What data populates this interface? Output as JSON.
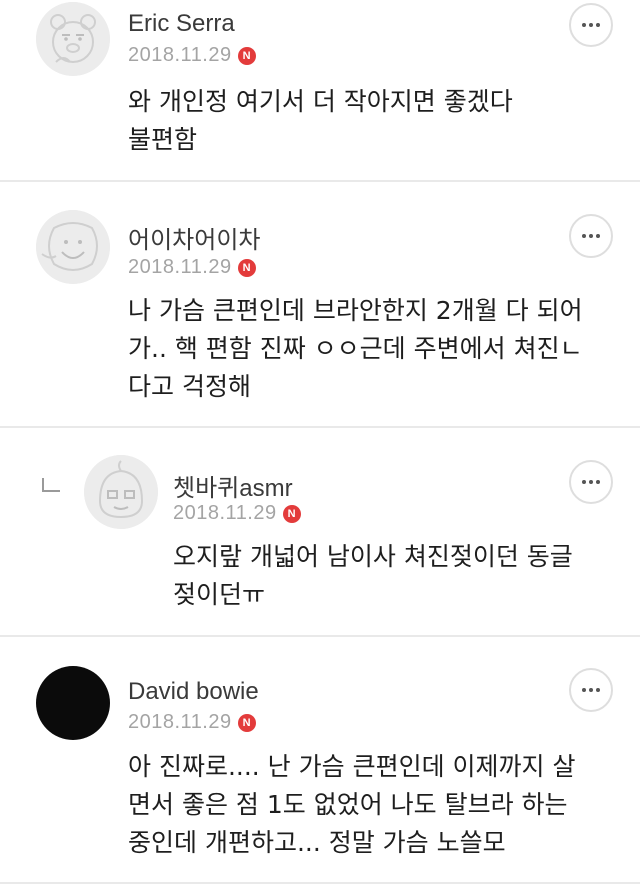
{
  "comments": [
    {
      "user": "Eric Serra",
      "date": "2018.11.29",
      "badge": "N",
      "lines": [
        "와 개인정 여기서 더 작아지면 좋겠다",
        "불편함"
      ],
      "avatar_icon": "ryan-character-avatar",
      "more_icon": "more-options-icon"
    },
    {
      "user": "어이차어이차",
      "date": "2018.11.29",
      "badge": "N",
      "lines": [
        "나 가슴 큰편인데 브라안한지 2개월 다 되어",
        "가.. 핵 편함 진짜 ㅇㅇ근데 주변에서 쳐진ㄴ",
        "다고 걱정해"
      ],
      "avatar_icon": "muzi-character-avatar",
      "more_icon": "more-options-icon"
    },
    {
      "user": "쳇바퀴asmr",
      "date": "2018.11.29",
      "badge": "N",
      "lines": [
        "오지랖 개넓어 남이사 쳐진젖이던 동글",
        "젖이던ㅠ"
      ],
      "avatar_icon": "apeach-character-avatar",
      "reply_icon": "reply-arrow-icon",
      "more_icon": "more-options-icon"
    },
    {
      "user": "David bowie",
      "date": "2018.11.29",
      "badge": "N",
      "lines": [
        "아 진짜로.... 난 가슴 큰편인데 이제까지 살",
        "면서 좋은 점 1도 없었어 나도 탈브라 하는",
        "중인데 개편하고... 정말 가슴 노쓸모"
      ],
      "avatar_icon": "black-circle-avatar",
      "more_icon": "more-options-icon"
    }
  ],
  "colors": {
    "badge": "#e33b3b",
    "date": "#a4a4a4",
    "divider": "#e9e9e9"
  }
}
